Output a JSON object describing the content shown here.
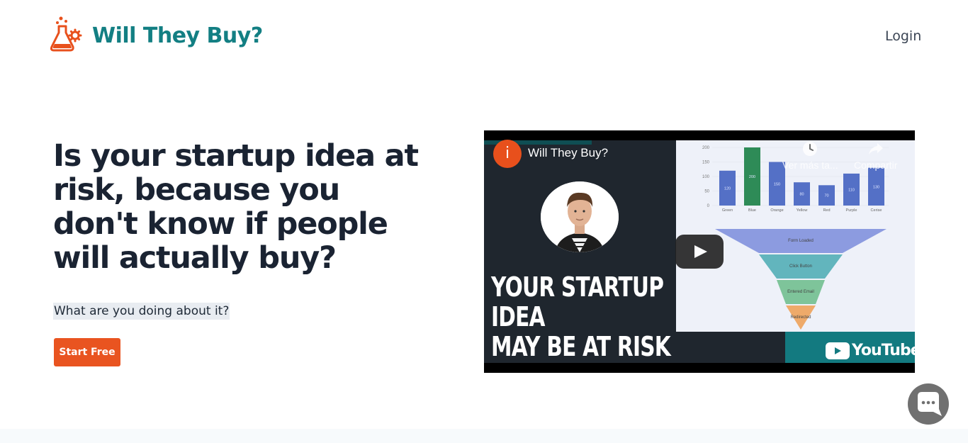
{
  "header": {
    "brand": "Will They Buy?",
    "login_label": "Login"
  },
  "hero": {
    "title": "Is your startup idea at risk, because you don't know if people will actually buy?",
    "subtitle": "What are you doing about it?",
    "cta_label": "Start Free"
  },
  "video": {
    "channel_initial": "i",
    "title": "Will They Buy?",
    "watch_later_label": "Ver más ta...",
    "share_label": "Compartir",
    "headline_lines": [
      "YOUR STARTUP",
      "IDEA",
      "MAY BE AT RISK"
    ],
    "platform": "YouTube",
    "chart_yticks": [
      "200",
      "150",
      "100",
      "50",
      "0"
    ],
    "chart_bars": [
      {
        "label": "Green",
        "value": 120,
        "color": "#5470c6"
      },
      {
        "label": "Blue",
        "value": 200,
        "color": "#2e8b57"
      },
      {
        "label": "Orange",
        "value": 150,
        "color": "#5470c6"
      },
      {
        "label": "Yellow",
        "value": 80,
        "color": "#5470c6"
      },
      {
        "label": "Red",
        "value": 70,
        "color": "#5470c6"
      },
      {
        "label": "Purple",
        "value": 110,
        "color": "#5470c6"
      },
      {
        "label": "Cerise",
        "value": 130,
        "color": "#5470c6"
      }
    ],
    "funnel_stages": [
      "Form Loaded",
      "Click Button",
      "Entered Email",
      "Redirected"
    ],
    "funnel_colors": [
      "#8c9be0",
      "#62b5bd",
      "#7ec49a",
      "#eeaa6a"
    ]
  },
  "colors": {
    "brand_teal": "#137f83",
    "cta_orange": "#e95420"
  },
  "icons": [
    "flask-gear-icon",
    "clock-icon",
    "share-icon",
    "play-icon",
    "youtube-icon",
    "chat-icon"
  ]
}
